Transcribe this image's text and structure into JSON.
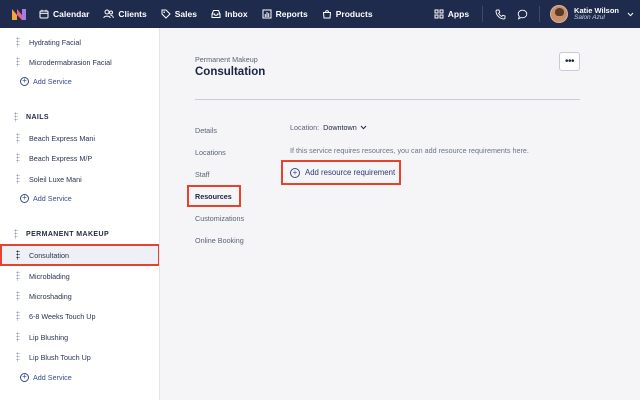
{
  "nav": {
    "items": [
      {
        "label": "Calendar",
        "icon": "calendar-icon"
      },
      {
        "label": "Clients",
        "icon": "clients-icon"
      },
      {
        "label": "Sales",
        "icon": "tag-icon"
      },
      {
        "label": "Inbox",
        "icon": "inbox-icon"
      },
      {
        "label": "Reports",
        "icon": "bar-chart-icon"
      },
      {
        "label": "Products",
        "icon": "bag-icon"
      }
    ],
    "apps_label": "Apps",
    "user": {
      "name": "Katie Wilson",
      "org": "Salon Azul"
    }
  },
  "sidebar": {
    "groups": [
      {
        "items": [
          "Hydrating Facial",
          "Microdermabrasion Facial"
        ],
        "add_label": "Add Service"
      },
      {
        "category": "NAILS",
        "items": [
          "Beach Express Mani",
          "Beach Express M/P",
          "Soleil Luxe Mani"
        ],
        "add_label": "Add Service"
      },
      {
        "category": "PERMANENT MAKEUP",
        "items": [
          "Consultation",
          "Microblading",
          "Microshading",
          "6-8 Weeks Touch Up",
          "Lip Blushing",
          "Lip Blush Touch Up"
        ],
        "add_label": "Add Service"
      }
    ],
    "selected": "Consultation"
  },
  "main": {
    "kicker": "Permanent Makeup",
    "title": "Consultation",
    "tabs": [
      "Details",
      "Locations",
      "Staff",
      "Resources",
      "Customizations",
      "Online Booking"
    ],
    "active_tab": "Resources",
    "location_label": "Location:",
    "location_value": "Downtown",
    "help_text": "If this service requires resources, you can add resource requirements here.",
    "add_requirement_label": "Add resource requirement"
  },
  "colors": {
    "nav_bg": "#1f2b4d",
    "highlight": "#e4432d",
    "accent": "#2d3a7a"
  }
}
